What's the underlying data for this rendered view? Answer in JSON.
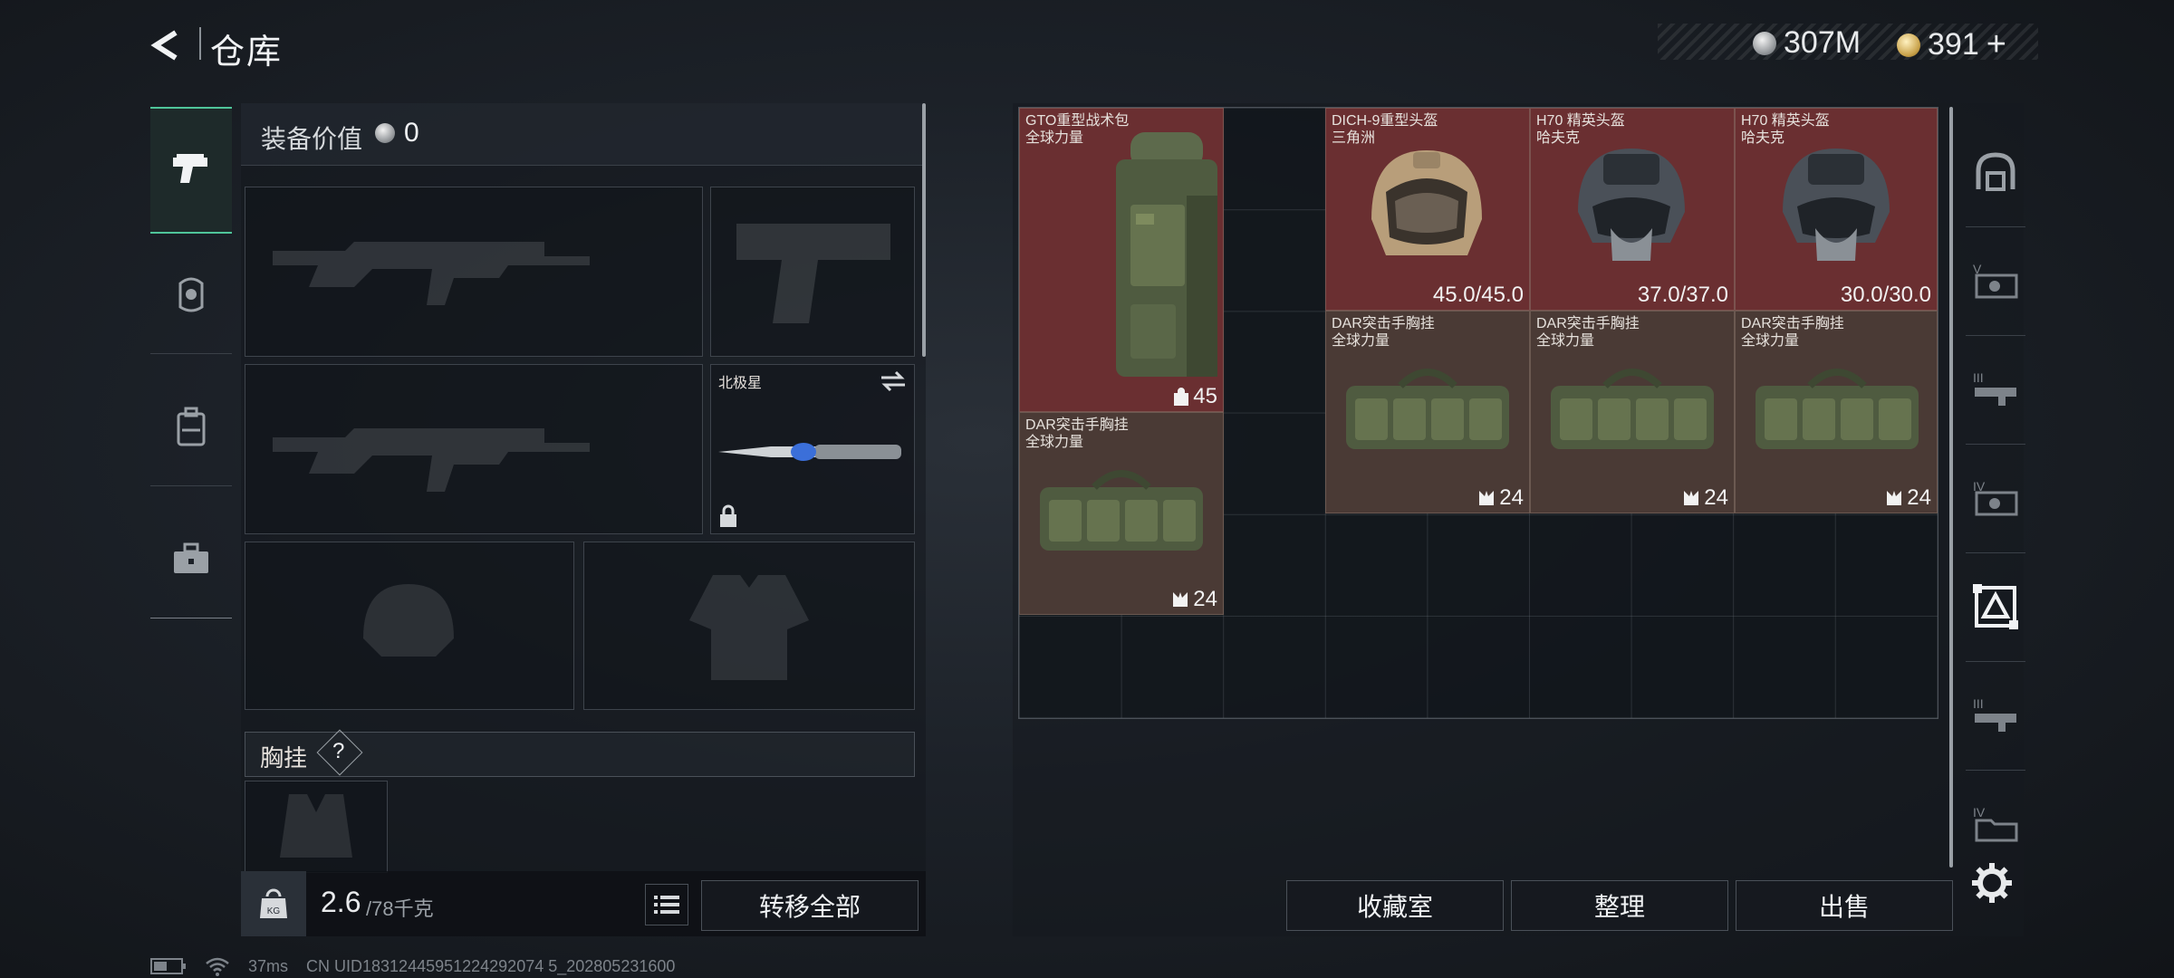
{
  "header": {
    "title": "仓库",
    "silver_amount": "307M",
    "gold_amount": "391",
    "gold_add": "+"
  },
  "categories": [
    {
      "icon": "pistol-icon",
      "active": true
    },
    {
      "icon": "helmet-icon",
      "active": false
    },
    {
      "icon": "vest-icon",
      "active": false
    },
    {
      "icon": "case-icon",
      "active": false
    }
  ],
  "equipment": {
    "value_label": "装备价值",
    "value": "0",
    "melee_name": "北极星",
    "chest_rig_label": "胸挂",
    "chest_rig_help": "?",
    "weight": "2.6",
    "weight_capacity": "/78千克",
    "transfer_all": "转移全部"
  },
  "storage_items": [
    {
      "name": "GTO重型战术包",
      "sub": "全球力量",
      "stat": "45",
      "stat_icon": "backpack-capacity-icon",
      "color": "red"
    },
    {
      "name": "DICH-9重型头盔",
      "sub": "三角洲",
      "stat": "45.0/45.0",
      "stat_icon": "",
      "color": "red"
    },
    {
      "name": "H70 精英头盔",
      "sub": "哈夫克",
      "stat": "37.0/37.0",
      "stat_icon": "",
      "color": "red"
    },
    {
      "name": "H70 精英头盔",
      "sub": "哈夫克",
      "stat": "30.0/30.0",
      "stat_icon": "",
      "color": "red"
    },
    {
      "name": "DAR突击手胸挂",
      "sub": "全球力量",
      "stat": "24",
      "stat_icon": "rig-capacity-icon",
      "color": "brown"
    },
    {
      "name": "DAR突击手胸挂",
      "sub": "全球力量",
      "stat": "24",
      "stat_icon": "rig-capacity-icon",
      "color": "brown"
    },
    {
      "name": "DAR突击手胸挂",
      "sub": "全球力量",
      "stat": "24",
      "stat_icon": "rig-capacity-icon",
      "color": "brown"
    },
    {
      "name": "DAR突击手胸挂",
      "sub": "全球力量",
      "stat": "24",
      "stat_icon": "rig-capacity-icon",
      "color": "brown"
    }
  ],
  "storage_buttons": {
    "collection": "收藏室",
    "sort": "整理",
    "sell": "出售"
  },
  "filters": [
    "helmet-filter-icon",
    "V",
    "III",
    "IV",
    "active-filter-icon",
    "III",
    "IV"
  ],
  "status_bar": {
    "ping": "37ms",
    "uid": "CN UID18312445951224292074 5_202805231600"
  },
  "colors": {
    "active_green": "#4fc59a",
    "rarity_red": "#6a2f31",
    "rarity_brown": "#4a3a35"
  }
}
